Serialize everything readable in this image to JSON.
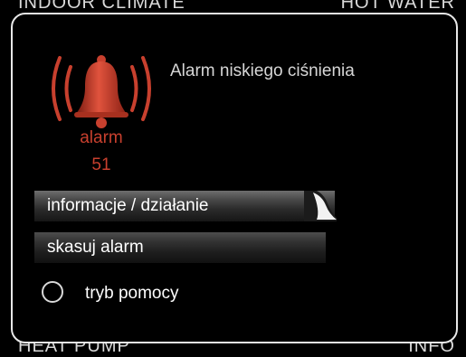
{
  "background_tabs": {
    "top_left": "INDOOR CLIMATE",
    "top_right": "HOT WATER",
    "bottom_left": "HEAT PUMP",
    "bottom_right": "INFO"
  },
  "alarm": {
    "icon": "bell-icon",
    "label": "alarm",
    "code": "51",
    "title": "Alarm niskiego ciśnienia",
    "color": "#c8402e"
  },
  "menu": {
    "items": [
      {
        "label": "informacje / działanie",
        "selected": true
      },
      {
        "label": "skasuj alarm",
        "selected": false
      }
    ],
    "help": {
      "icon": "radio-circle-icon",
      "label": "tryb pomocy"
    }
  }
}
